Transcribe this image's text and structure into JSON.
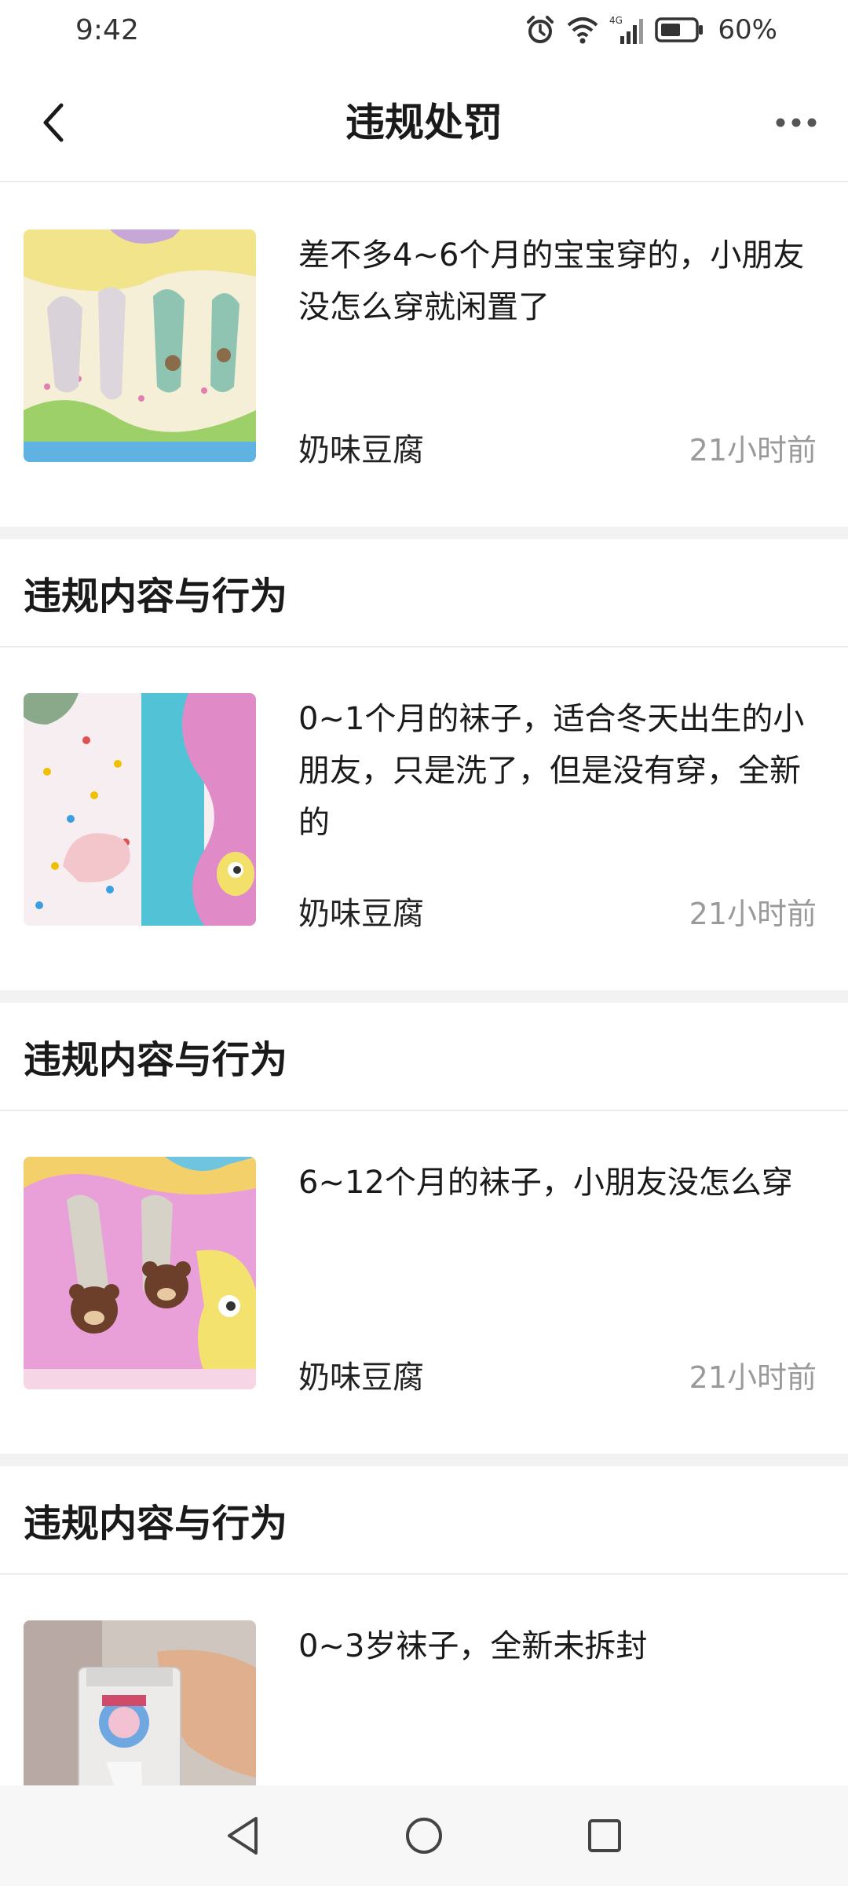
{
  "status_bar": {
    "time": "9:42",
    "network": "4G",
    "battery": "60%"
  },
  "nav": {
    "title": "违规处罚",
    "back_icon": "chevron-left-icon",
    "more_icon": "more-horizontal-icon"
  },
  "section_title": "违规内容与行为",
  "posts": [
    {
      "text": "差不多4~6个月的宝宝穿的，小朋友没怎么穿就闲置了",
      "author": "奶味豆腐",
      "time": "21小时前"
    },
    {
      "text": "0~1个月的袜子，适合冬天出生的小朋友，只是洗了，但是没有穿，全新的",
      "author": "奶味豆腐",
      "time": "21小时前"
    },
    {
      "text": "6~12个月的袜子，小朋友没怎么穿",
      "author": "奶味豆腐",
      "time": "21小时前"
    },
    {
      "text": "0~3岁袜子，全新未拆封",
      "author": "",
      "time": ""
    }
  ],
  "colors": {
    "separator": "#f2f2f2",
    "muted_text": "#9a9a9a",
    "primary_text": "#1a1a1a"
  }
}
